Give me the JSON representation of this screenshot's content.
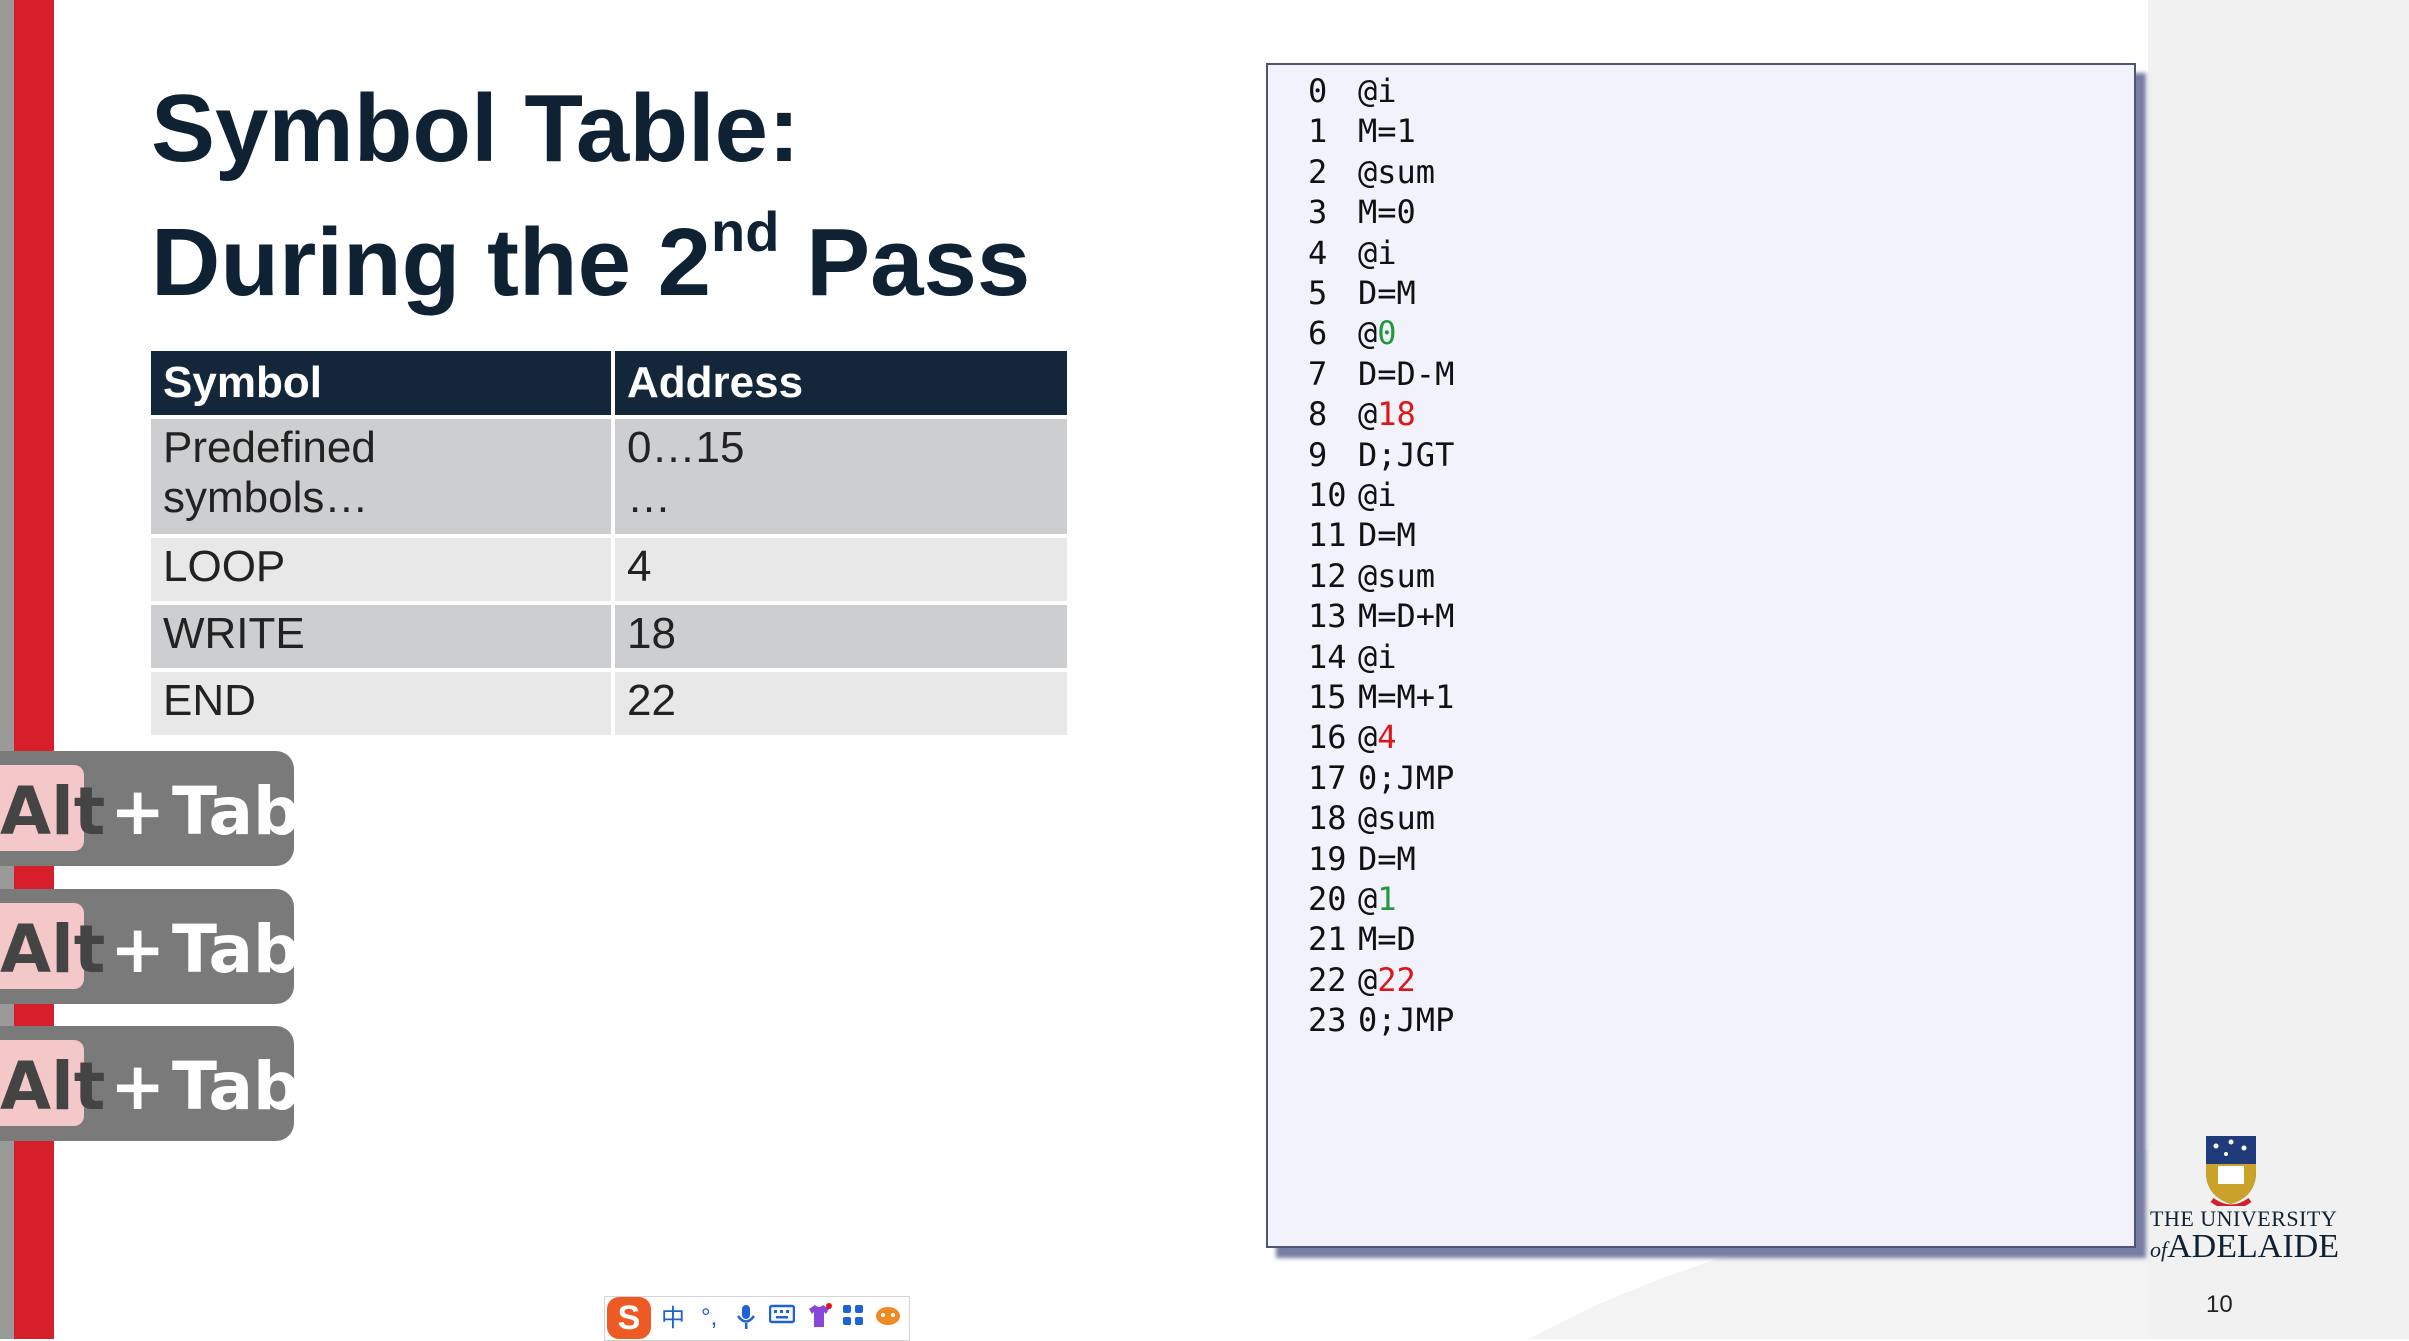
{
  "slide": {
    "title_line1": "Symbol Table:",
    "title_line2_pre": "During the 2",
    "title_line2_sup": "nd",
    "title_line2_post": " Pass",
    "page_number": "10"
  },
  "symbol_table": {
    "headers": [
      "Symbol",
      "Address"
    ],
    "rows": [
      {
        "symbol": [
          "Predefined",
          "symbols…"
        ],
        "address": [
          "0…15",
          "…"
        ]
      },
      {
        "symbol": [
          "LOOP"
        ],
        "address": [
          "4"
        ]
      },
      {
        "symbol": [
          "WRITE"
        ],
        "address": [
          "18"
        ]
      },
      {
        "symbol": [
          "END"
        ],
        "address": [
          "22"
        ]
      }
    ]
  },
  "overlays": {
    "alt_tab": [
      {
        "key": "Alt",
        "plus": "+",
        "tab": "Tab"
      },
      {
        "key": "Alt",
        "plus": "+",
        "tab": "Tab"
      },
      {
        "key": "Alt",
        "plus": "+",
        "tab": "Tab"
      }
    ]
  },
  "code": {
    "lines": [
      {
        "num": "0",
        "text": "@i"
      },
      {
        "num": "1",
        "text": "M=1"
      },
      {
        "num": "2",
        "text": "@sum"
      },
      {
        "num": "3",
        "text": "M=0"
      },
      {
        "num": "4",
        "text": "@i"
      },
      {
        "num": "5",
        "text": "D=M"
      },
      {
        "num": "6",
        "prefix": "@",
        "value": "0",
        "highlight": "green"
      },
      {
        "num": "7",
        "text": "D=D-M"
      },
      {
        "num": "8",
        "prefix": "@",
        "value": "18",
        "highlight": "red"
      },
      {
        "num": "9",
        "text": "D;JGT"
      },
      {
        "num": "10",
        "text": "@i"
      },
      {
        "num": "11",
        "text": "D=M"
      },
      {
        "num": "12",
        "text": "@sum"
      },
      {
        "num": "13",
        "text": "M=D+M"
      },
      {
        "num": "14",
        "text": "@i"
      },
      {
        "num": "15",
        "text": "M=M+1"
      },
      {
        "num": "16",
        "prefix": "@",
        "value": "4",
        "highlight": "red"
      },
      {
        "num": "17",
        "text": "0;JMP"
      },
      {
        "num": "18",
        "text": "@sum"
      },
      {
        "num": "19",
        "text": "D=M"
      },
      {
        "num": "20",
        "prefix": "@",
        "value": "1",
        "highlight": "green"
      },
      {
        "num": "21",
        "text": "M=D"
      },
      {
        "num": "22",
        "prefix": "@",
        "value": "22",
        "highlight": "red"
      },
      {
        "num": "23",
        "text": "0;JMP"
      }
    ]
  },
  "logo": {
    "line1": "THE UNIVERSITY",
    "line2_prefix": "of",
    "line2": "ADELAIDE",
    "icon": "university-crest-icon"
  },
  "ime_toolbar": {
    "logo": "S",
    "mode": "中",
    "punct": "°,",
    "icons": [
      "microphone-icon",
      "keyboard-icon",
      "skin-icon",
      "apps-icon",
      "mascot-icon"
    ]
  },
  "colors": {
    "accent_red": "#d61f2b",
    "title_navy": "#0f2233",
    "header_bg": "#14263a",
    "code_green": "#1f9a3a",
    "code_red": "#e01515",
    "code_panel_bg": "#f2f2fd"
  }
}
